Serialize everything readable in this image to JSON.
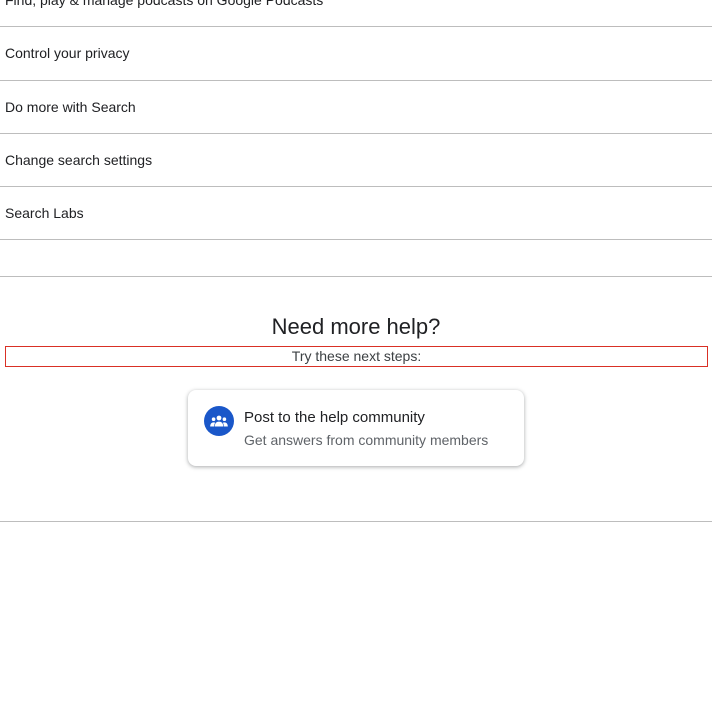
{
  "topics": [
    {
      "label": "Find, play & manage podcasts on Google Podcasts"
    },
    {
      "label": "Control your privacy"
    },
    {
      "label": "Do more with Search"
    },
    {
      "label": "Change search settings"
    },
    {
      "label": "Search Labs"
    }
  ],
  "help": {
    "title": "Need more help?",
    "subtitle": "Try these next steps:",
    "card": {
      "icon": "groups-icon",
      "title": "Post to the help community",
      "description": "Get answers from community members"
    }
  },
  "colors": {
    "accent": "#1a57c9",
    "highlight_border": "#d93025",
    "divider": "#bdbdbd"
  }
}
